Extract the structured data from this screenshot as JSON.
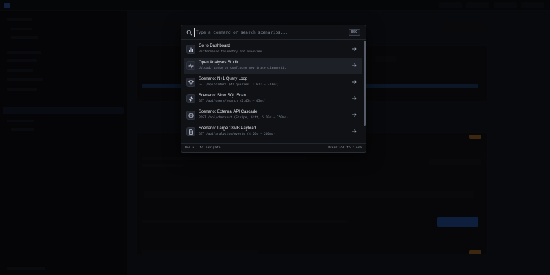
{
  "palette": {
    "search_placeholder": "Type a command or search scenarios...",
    "esc_label": "ESC",
    "items": [
      {
        "title": "Go to Dashboard",
        "subtitle": "Performance telemetry and overview",
        "icon": "bar-chart-icon",
        "active": false
      },
      {
        "title": "Open Analyses Studio",
        "subtitle": "Upload, paste or configure new trace diagnostic",
        "icon": "activity-icon",
        "active": true
      },
      {
        "title": "Scenario: N+1 Query Loop",
        "subtitle": "GET /api/orders (42 queries, 1.82s — 210ms)",
        "icon": "layers-icon",
        "active": false
      },
      {
        "title": "Scenario: Slow SQL Scan",
        "subtitle": "GET /api/users/search (2.45s — 45ms)",
        "icon": "bolt-icon",
        "active": false
      },
      {
        "title": "Scenario: External API Cascade",
        "subtitle": "POST /api/checkout (Stripe, Gift, 5.10s — 750ms)",
        "icon": "globe-icon",
        "active": false
      },
      {
        "title": "Scenario: Large 18MB Payload",
        "subtitle": "GET /api/analytics/events (4.20s — 260ms)",
        "icon": "file-icon",
        "active": false
      }
    ],
    "footer_hint_left": "Use ↑ ↓ to navigate",
    "footer_hint_right": "Press ESC to close"
  },
  "colors": {
    "accent": "#2d6cd4",
    "warning": "#d98a2b",
    "panel_bg": "#0f1115",
    "active_row": "#1d2027"
  }
}
